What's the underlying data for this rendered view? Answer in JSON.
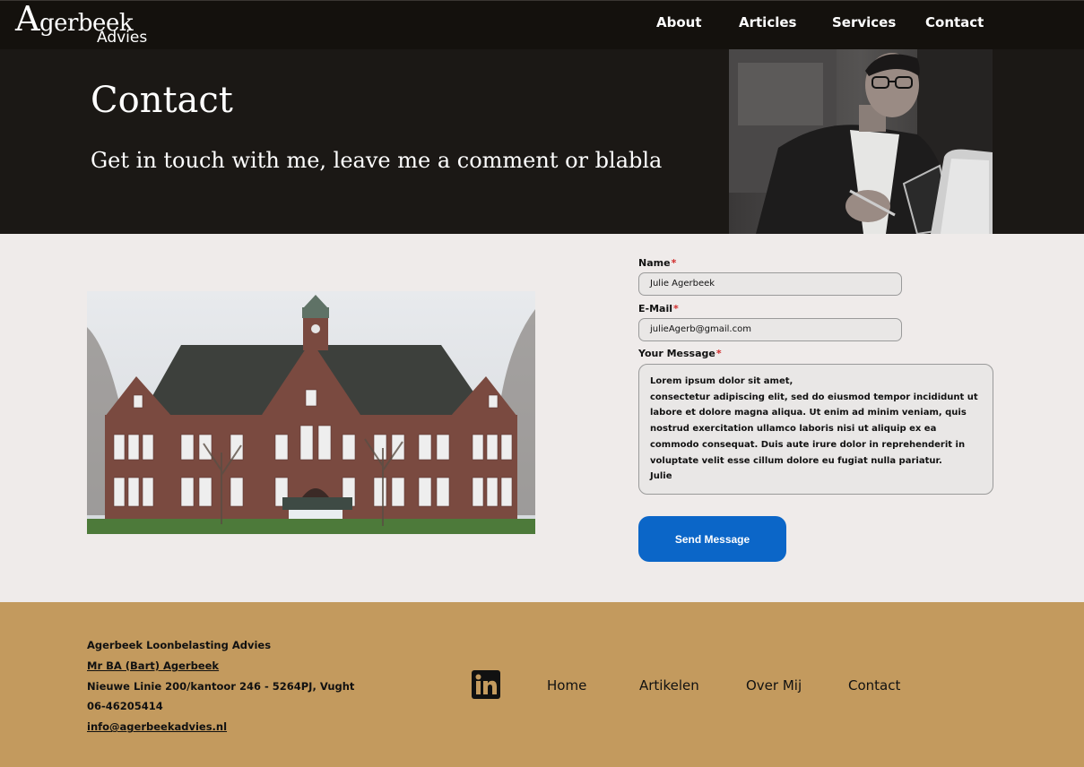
{
  "logo": {
    "initial": "A",
    "rest": "gerbeek",
    "sub": "Advies"
  },
  "nav": [
    "About",
    "Articles",
    "Services",
    "Contact"
  ],
  "hero": {
    "title": "Contact",
    "subtitle": "Get in touch with me, leave me a comment or blabla"
  },
  "form": {
    "name_label": "Name",
    "name_value": "Julie Agerbeek",
    "email_label": "E-Mail",
    "email_value": "julieAgerb@gmail.com",
    "message_label": "Your Message",
    "required_marker": "*",
    "message_value": "Lorem ipsum dolor sit amet,\nconsectetur adipiscing elit, sed do eiusmod tempor incididunt ut labore et dolore magna aliqua. Ut enim ad minim veniam, quis nostrud exercitation ullamco laboris nisi ut aliquip ex ea commodo consequat. Duis aute irure dolor in reprehenderit in voluptate velit esse cillum dolore eu fugiat nulla pariatur.\nJulie",
    "send_label": "Send Message"
  },
  "footer": {
    "company": "Agerbeek Loonbelasting Advies",
    "person": "Mr BA (Bart) Agerbeek",
    "address": "Nieuwe Linie 200/kantoor 246 - 5264PJ, Vught",
    "phone": "06-46205414",
    "email": "info@agerbeekadvies.nl",
    "social_icon": "linkedin-icon",
    "links": [
      "Home",
      "Artikelen",
      "Over Mij",
      "Contact"
    ]
  },
  "colors": {
    "nav_bg": "#14110d",
    "hero_bg": "#1b1815",
    "body_bg": "#efebea",
    "footer_bg": "#c39a5e",
    "button": "#0b66c8",
    "required": "#d12b2b"
  }
}
